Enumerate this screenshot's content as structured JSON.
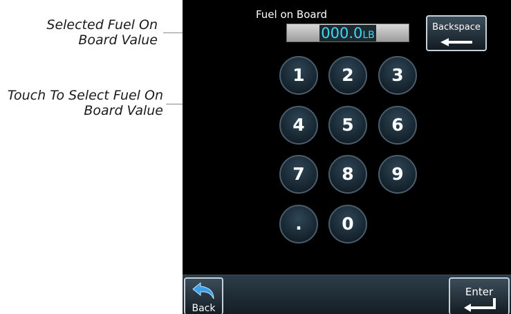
{
  "callouts": {
    "selected_value": [
      "Selected Fuel On",
      "Board Value"
    ],
    "touch_select": [
      "Touch To Select Fuel On",
      "Board Value"
    ]
  },
  "screen": {
    "title": "Fuel on Board",
    "value": "000.0",
    "unit": "LB",
    "backspace_label": "Backspace",
    "keypad": [
      "1",
      "2",
      "3",
      "4",
      "5",
      "6",
      "7",
      "8",
      "9",
      ".",
      "0"
    ],
    "back_label": "Back",
    "enter_label": "Enter"
  },
  "colors": {
    "screen_bg": "#000000",
    "value_text": "#3fd8f2",
    "key_border": "#4a5d6b"
  },
  "icons": {
    "backspace": "arrow-left-icon",
    "back": "curved-back-arrow-icon",
    "enter": "enter-return-icon"
  }
}
